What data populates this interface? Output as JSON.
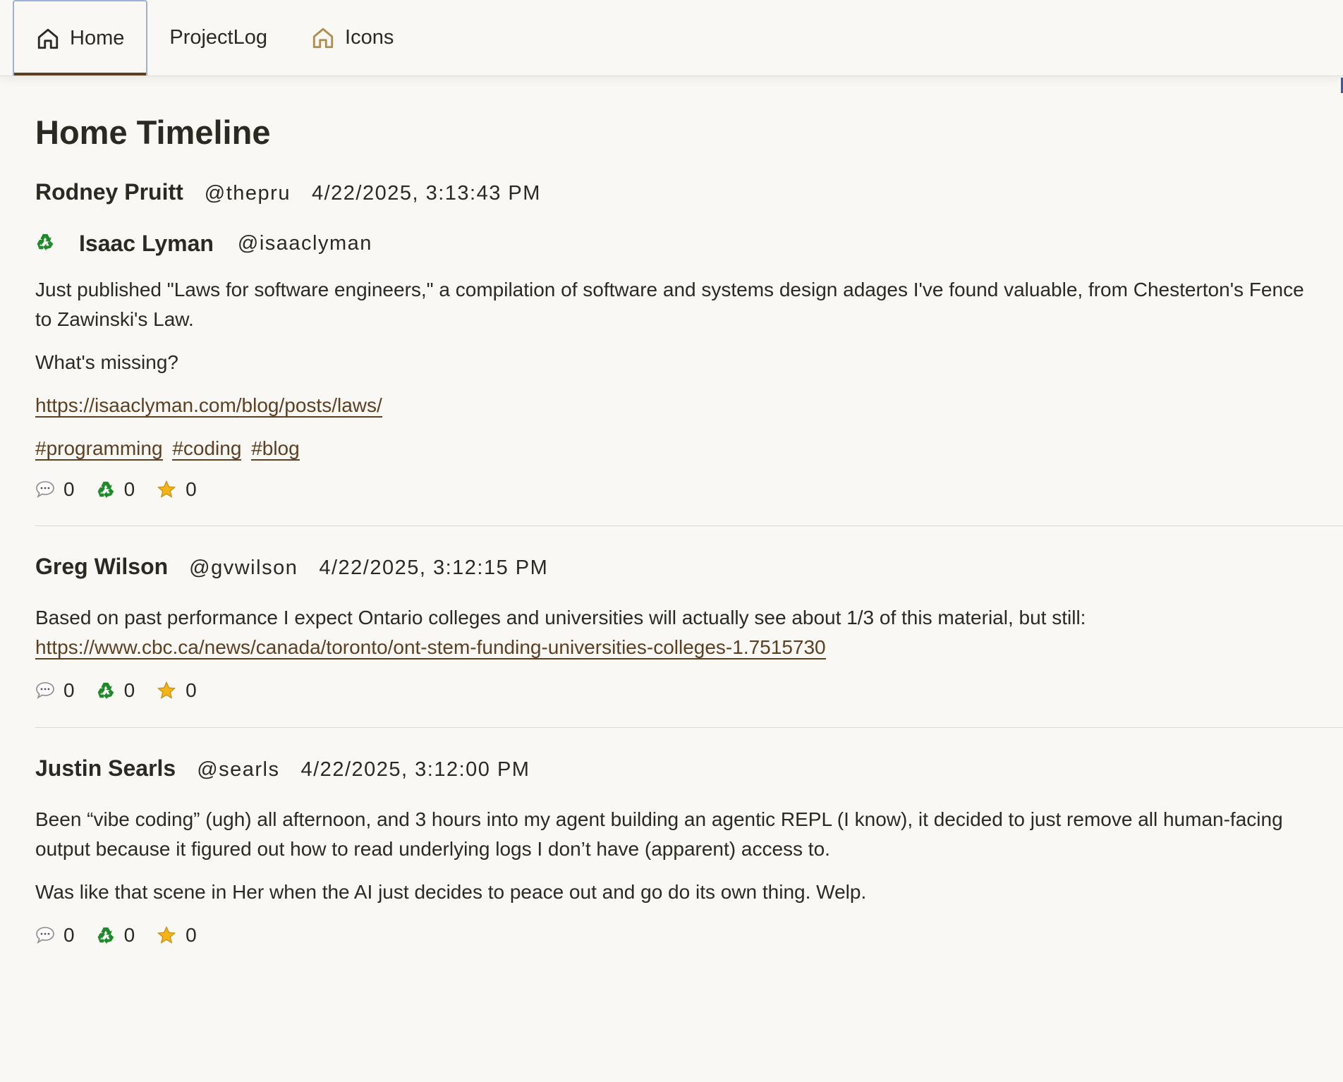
{
  "tabs": [
    {
      "label": "Home",
      "icon": "home-icon"
    },
    {
      "label": "ProjectLog"
    },
    {
      "label": "Icons",
      "icon": "home-icon"
    }
  ],
  "page_title": "Home Timeline",
  "posts": [
    {
      "author": "Rodney Pruitt",
      "handle": "@thepru",
      "timestamp": "4/22/2025, 3:13:43 PM",
      "boosted": {
        "author": "Isaac Lyman",
        "handle": "@isaaclyman"
      },
      "paragraphs": [
        "Just published \"Laws for software engineers,\" a compilation of software and systems design adages I've found valuable, from Chesterton's Fence to Zawinski's Law.",
        "What's missing?"
      ],
      "link": "https://isaaclyman.com/blog/posts/laws/",
      "tags": [
        "#programming",
        "#coding",
        "#blog"
      ],
      "replies": "0",
      "boosts": "0",
      "favorites": "0"
    },
    {
      "author": "Greg Wilson",
      "handle": "@gvwilson",
      "timestamp": "4/22/2025, 3:12:15 PM",
      "text": "Based on past performance I expect Ontario colleges and universities will actually see about 1/3 of this material, but still:",
      "link": "https://www.cbc.ca/news/canada/toronto/ont-stem-funding-universities-colleges-1.7515730",
      "replies": "0",
      "boosts": "0",
      "favorites": "0"
    },
    {
      "author": "Justin Searls",
      "handle": "@searls",
      "timestamp": "4/22/2025, 3:12:00 PM",
      "paragraphs": [
        "Been “vibe coding” (ugh) all afternoon, and 3 hours into my agent building an agentic REPL (I know), it decided to just remove all human-facing output because it figured out how to read underlying logs I don’t have (apparent) access to.",
        "Was like that scene in Her when the AI just decides to peace out and go do its own thing. Welp."
      ],
      "replies": "0",
      "boosts": "0",
      "favorites": "0"
    }
  ],
  "icons": {
    "reply": "speech-bubble-icon",
    "boost": "recycle-icon",
    "favorite": "star-icon"
  },
  "colors": {
    "background": "#faf8f4",
    "link": "#5d3f22",
    "recycle": "#1f8a2c",
    "star": "#f2b418",
    "active_tab_border": "#9cb2dc"
  }
}
